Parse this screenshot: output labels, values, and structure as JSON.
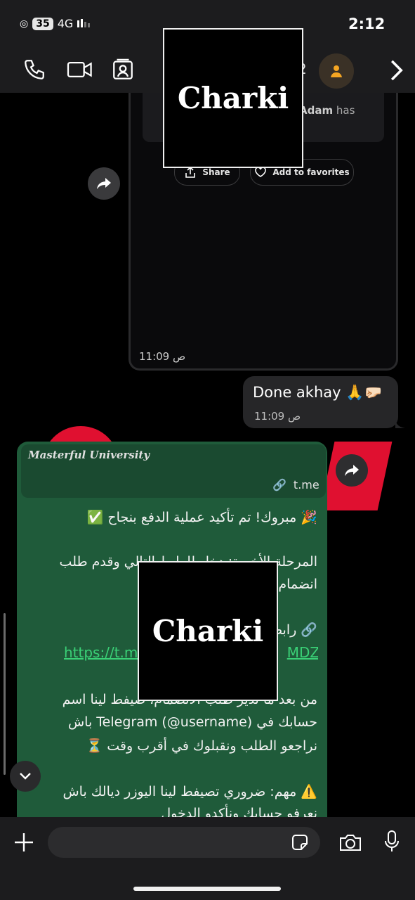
{
  "status_bar": {
    "battery": "35",
    "network": "4G",
    "time": "2:12"
  },
  "header": {
    "title_fragment": "2",
    "icons": [
      "phone-icon",
      "video-icon",
      "contact-card-icon",
      "avatar-icon",
      "chevron-right-icon"
    ]
  },
  "watermark": {
    "text": "Charki"
  },
  "media_message": {
    "card_name": "Adam",
    "card_text": "has",
    "share_label": "Share",
    "favorite_label": "Add to favorites",
    "time": "11:09 ص"
  },
  "outgoing_message": {
    "text": "Done akhay 🙏🤛🏻",
    "time": "11:09 ص"
  },
  "green_message": {
    "link_title": "Masterful University",
    "link_domain": "t.me",
    "line1": "🎉 مبروك! تم تأكيد عملية الدفع بنجاح ✅",
    "line2": "المرحلة الأخيرة: دخل للرابط التالي وقدم طلب",
    "line3": "انضمام",
    "line4": "🔗 رابط",
    "url": "https://t.me",
    "url_tail": "MDZk",
    "line5": "من بعد ما تدير طلب الانضمام، صيفط لينا اسم",
    "line6": "حسابك في Telegram (@username) باش",
    "line7": "نراجعو الطلب ونقبلوك في أقرب وقت ⏳",
    "line8": "⚠️ مهم: ضروري تصيفط لينا اليوزر ديالك باش",
    "line9": "نعرفو حسابك ونأكدو الدخول"
  },
  "composer": {
    "placeholder": ""
  }
}
